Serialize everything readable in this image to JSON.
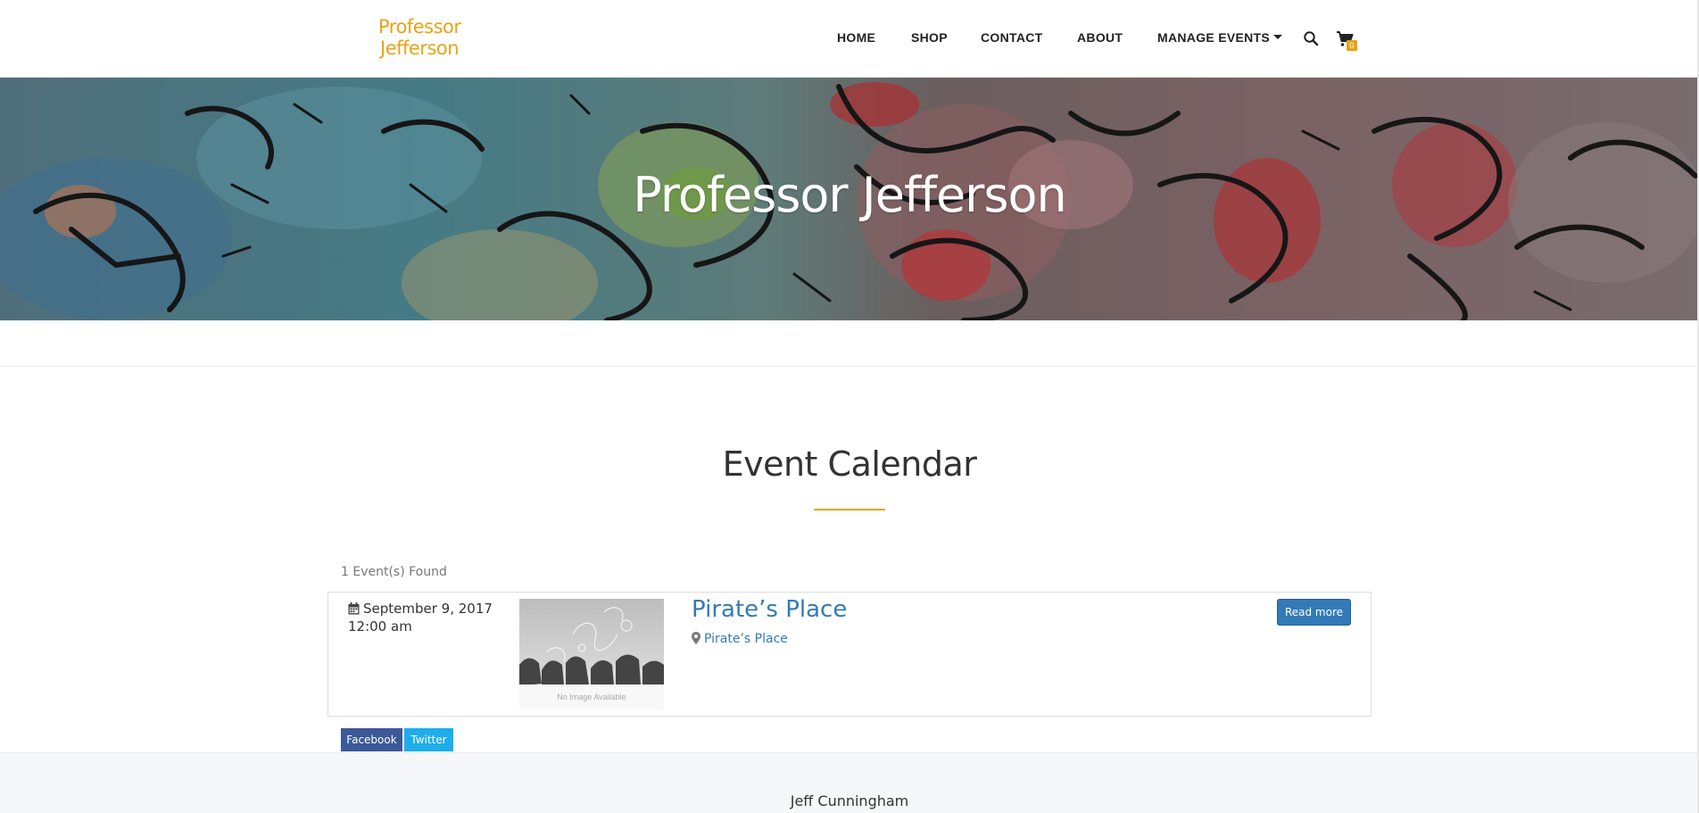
{
  "colors": {
    "brand": "#e8a317",
    "link": "#337ab7",
    "button": "#337ab7",
    "facebook": "#3b5998",
    "twitter": "#1dadeb",
    "accent_line": "#e8a317",
    "cart_badge": "#e8a317"
  },
  "header": {
    "logo_line1": "Professor",
    "logo_line2": "Jefferson",
    "nav": [
      {
        "label": "HOME"
      },
      {
        "label": "SHOP"
      },
      {
        "label": "CONTACT"
      },
      {
        "label": "ABOUT"
      },
      {
        "label": "MANAGE EVENTS"
      }
    ],
    "search_icon": "search-icon",
    "cart_icon": "cart-icon",
    "cart_count": "0"
  },
  "hero": {
    "title": "Professor Jefferson"
  },
  "events": {
    "heading": "Event Calendar",
    "found_text": "1 Event(s) Found",
    "items": [
      {
        "date": "September 9, 2017",
        "time": "12:00 am",
        "image_caption": "No Image Available",
        "title": "Pirate’s Place",
        "location": "Pirate’s Place",
        "read_more": "Read more"
      }
    ]
  },
  "share": {
    "facebook": "Facebook",
    "twitter": "Twitter"
  },
  "footer": {
    "name": "Jeff Cunningham"
  }
}
